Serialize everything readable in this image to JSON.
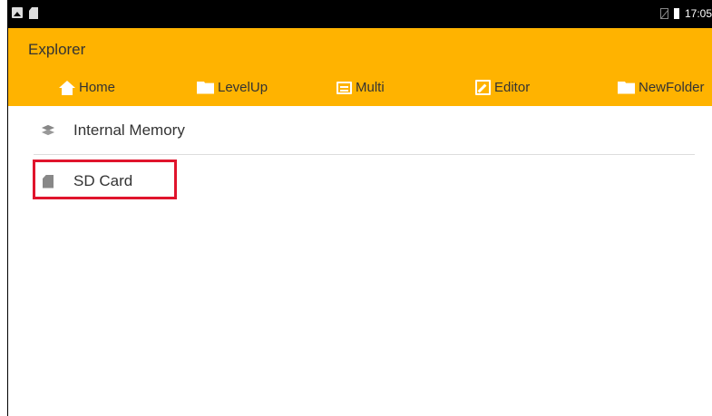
{
  "status_bar": {
    "left_icons": [
      "image-icon",
      "sd-card-icon"
    ],
    "right_icons": [
      "no-sim-icon",
      "battery-icon"
    ],
    "time": "17:05"
  },
  "app_bar": {
    "title": "Explorer",
    "toolbar": [
      {
        "label": "Home",
        "icon": "home-icon"
      },
      {
        "label": "LevelUp",
        "icon": "folder-up-icon"
      },
      {
        "label": "Multi",
        "icon": "multi-select-icon"
      },
      {
        "label": "Editor",
        "icon": "edit-icon"
      },
      {
        "label": "NewFolder",
        "icon": "new-folder-icon"
      }
    ]
  },
  "storage_list": [
    {
      "label": "Internal Memory",
      "icon": "layers-icon"
    },
    {
      "label": "SD Card",
      "icon": "sd-card-icon",
      "highlighted": true
    }
  ],
  "colors": {
    "app_bar": "#ffb300",
    "status_bar": "#000000",
    "highlight": "#e0142c",
    "toolbar_icon": "#ffffff",
    "text": "#333333"
  }
}
